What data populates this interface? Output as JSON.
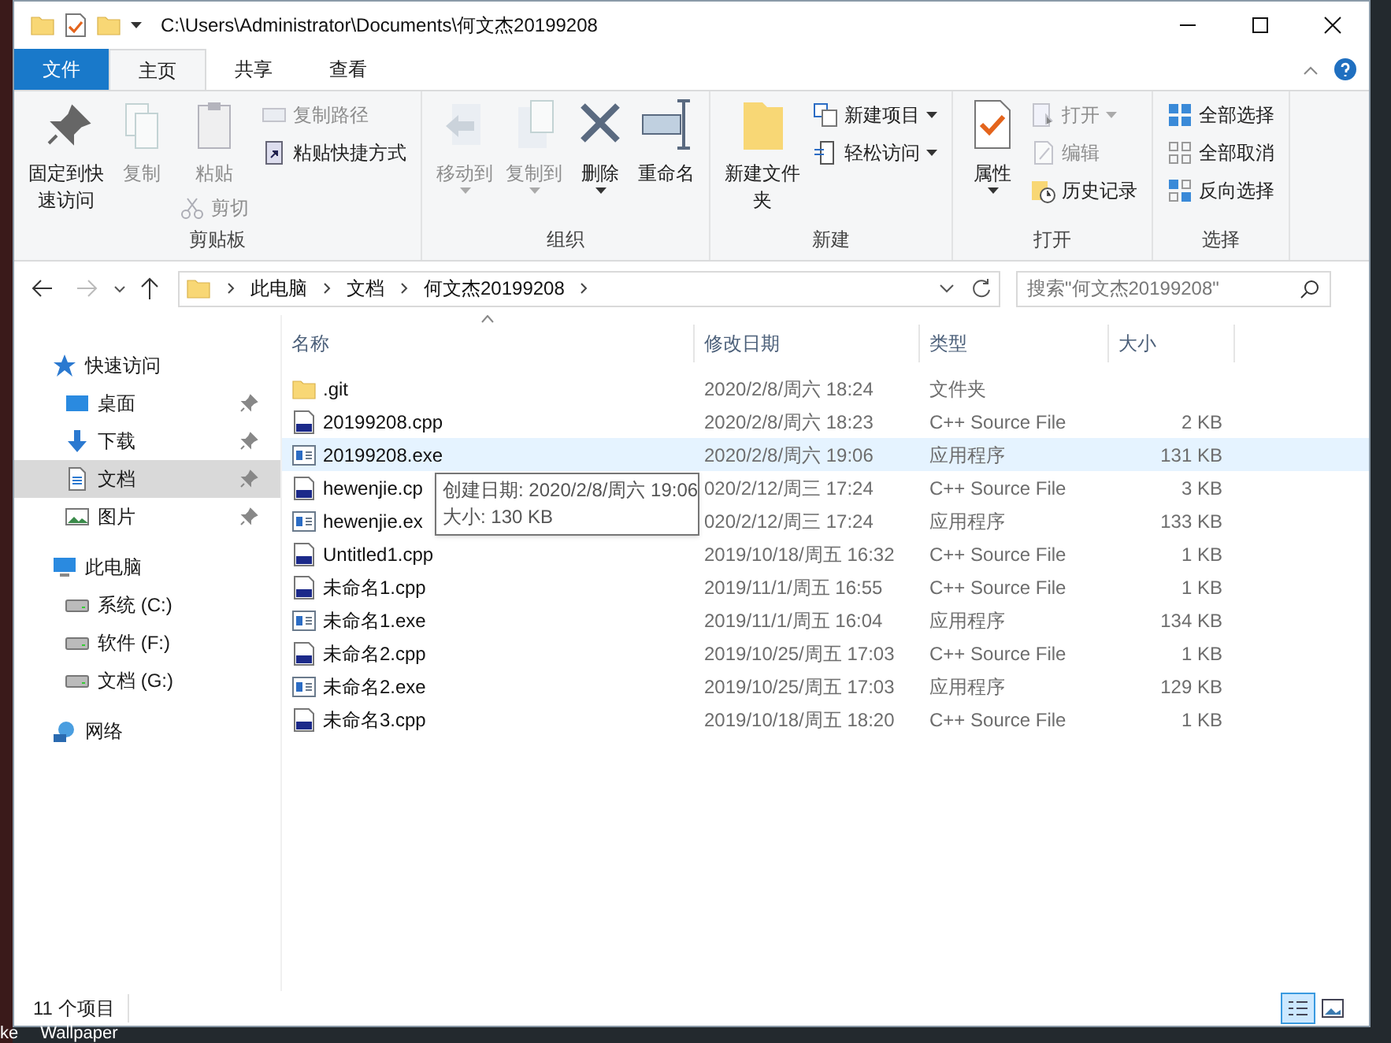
{
  "window": {
    "title": "C:\\Users\\Administrator\\Documents\\何文杰20199208"
  },
  "tabs": [
    {
      "label": "文件",
      "kind": "file",
      "selected": false
    },
    {
      "label": "主页",
      "kind": "tab",
      "selected": true
    },
    {
      "label": "共享",
      "kind": "tab",
      "selected": false
    },
    {
      "label": "查看",
      "kind": "tab",
      "selected": false
    }
  ],
  "ribbon": [
    {
      "label": "剪贴板",
      "columns": [
        [
          {
            "label": "固定到快速访问",
            "kind": "large",
            "disabled": false,
            "dropdown": false
          }
        ],
        [
          {
            "label": "复制",
            "kind": "large",
            "disabled": true,
            "dropdown": false
          }
        ],
        [
          {
            "label": "粘贴",
            "kind": "large",
            "disabled": true,
            "dropdown": false
          },
          {
            "label": "剪切",
            "kind": "small",
            "disabled": true,
            "dropdown": false
          }
        ],
        [
          {
            "label": "复制路径",
            "kind": "small",
            "disabled": true,
            "dropdown": false
          },
          {
            "label": "粘贴快捷方式",
            "kind": "small",
            "disabled": false,
            "dropdown": false
          }
        ]
      ]
    },
    {
      "label": "组织",
      "columns": [
        [
          {
            "label": "移动到",
            "kind": "large",
            "disabled": true,
            "dropdown": true
          }
        ],
        [
          {
            "label": "复制到",
            "kind": "large",
            "disabled": true,
            "dropdown": true
          }
        ],
        [
          {
            "label": "删除",
            "kind": "large",
            "disabled": false,
            "dropdown": true
          }
        ],
        [
          {
            "label": "重命名",
            "kind": "large",
            "disabled": false,
            "dropdown": false
          }
        ]
      ]
    },
    {
      "label": "新建",
      "columns": [
        [
          {
            "label": "新建文件夹",
            "kind": "large",
            "disabled": false,
            "dropdown": false
          }
        ],
        [
          {
            "label": "新建项目",
            "kind": "small",
            "disabled": false,
            "dropdown": true
          },
          {
            "label": "轻松访问",
            "kind": "small",
            "disabled": false,
            "dropdown": true
          }
        ]
      ]
    },
    {
      "label": "打开",
      "columns": [
        [
          {
            "label": "属性",
            "kind": "large",
            "disabled": false,
            "dropdown": true
          }
        ],
        [
          {
            "label": "打开",
            "kind": "small",
            "disabled": true,
            "dropdown": true
          },
          {
            "label": "编辑",
            "kind": "small",
            "disabled": true,
            "dropdown": false
          },
          {
            "label": "历史记录",
            "kind": "small",
            "disabled": false,
            "dropdown": false
          }
        ]
      ]
    },
    {
      "label": "选择",
      "columns": [
        [
          {
            "label": "全部选择",
            "kind": "small",
            "disabled": false,
            "dropdown": false
          },
          {
            "label": "全部取消",
            "kind": "small",
            "disabled": false,
            "dropdown": false
          },
          {
            "label": "反向选择",
            "kind": "small",
            "disabled": false,
            "dropdown": false
          }
        ]
      ]
    }
  ],
  "address": {
    "crumbs": [
      "此电脑",
      "文档",
      "何文杰20199208"
    ],
    "search_placeholder": "搜索\"何文杰20199208\""
  },
  "sidebar": {
    "items": [
      {
        "label": "快速访问",
        "kind": "star",
        "selected": false,
        "children": [
          {
            "label": "桌面",
            "kind": "desktop",
            "selected": false,
            "pinned": true
          },
          {
            "label": "下载",
            "kind": "download",
            "selected": false,
            "pinned": true
          },
          {
            "label": "文档",
            "kind": "document",
            "selected": true,
            "pinned": true
          },
          {
            "label": "图片",
            "kind": "picture",
            "selected": false,
            "pinned": true
          }
        ]
      },
      {
        "label": "此电脑",
        "kind": "pc",
        "selected": false,
        "children": [
          {
            "label": "系统 (C:)",
            "kind": "drive",
            "selected": false,
            "pinned": false
          },
          {
            "label": "软件 (F:)",
            "kind": "drive",
            "selected": false,
            "pinned": false
          },
          {
            "label": "文档 (G:)",
            "kind": "drive",
            "selected": false,
            "pinned": false
          }
        ]
      },
      {
        "label": "网络",
        "kind": "network",
        "selected": false
      }
    ]
  },
  "table": {
    "columns": [
      "名称",
      "修改日期",
      "类型",
      "大小"
    ],
    "rows": [
      {
        "name": ".git",
        "date": "2020/2/8/周六 18:24",
        "type": "文件夹",
        "size": "",
        "kind": "folder",
        "hovered": false
      },
      {
        "name": "20199208.cpp",
        "date": "2020/2/8/周六 18:23",
        "type": "C++ Source File",
        "size": "2 KB",
        "kind": "cpp",
        "hovered": false
      },
      {
        "name": "20199208.exe",
        "date": "2020/2/8/周六 19:06",
        "type": "应用程序",
        "size": "131 KB",
        "kind": "exe",
        "hovered": true
      },
      {
        "name": "hewenjie.cp",
        "date": "020/2/12/周三 17:24",
        "type": "C++ Source File",
        "size": "3 KB",
        "kind": "cpp",
        "hovered": false
      },
      {
        "name": "hewenjie.ex",
        "date": "020/2/12/周三 17:24",
        "type": "应用程序",
        "size": "133 KB",
        "kind": "exe",
        "hovered": false
      },
      {
        "name": "Untitled1.cpp",
        "date": "2019/10/18/周五 16:32",
        "type": "C++ Source File",
        "size": "1 KB",
        "kind": "cpp",
        "hovered": false
      },
      {
        "name": "未命名1.cpp",
        "date": "2019/11/1/周五 16:55",
        "type": "C++ Source File",
        "size": "1 KB",
        "kind": "cpp",
        "hovered": false
      },
      {
        "name": "未命名1.exe",
        "date": "2019/11/1/周五 16:04",
        "type": "应用程序",
        "size": "134 KB",
        "kind": "exe",
        "hovered": false
      },
      {
        "name": "未命名2.cpp",
        "date": "2019/10/25/周五 17:03",
        "type": "C++ Source File",
        "size": "1 KB",
        "kind": "cpp",
        "hovered": false
      },
      {
        "name": "未命名2.exe",
        "date": "2019/10/25/周五 17:03",
        "type": "应用程序",
        "size": "129 KB",
        "kind": "exe",
        "hovered": false
      },
      {
        "name": "未命名3.cpp",
        "date": "2019/10/18/周五 18:20",
        "type": "C++ Source File",
        "size": "1 KB",
        "kind": "cpp",
        "hovered": false
      }
    ]
  },
  "tooltip": [
    "创建日期: 2020/2/8/周六 19:06",
    "大小: 130 KB"
  ],
  "status_bar": {
    "count": "11 个项目",
    "views": [
      {
        "kind": "details",
        "selected": true
      },
      {
        "kind": "thumbnails",
        "selected": false
      }
    ]
  },
  "desktop": {
    "labels": [
      "ke",
      "Wallpaper"
    ]
  }
}
